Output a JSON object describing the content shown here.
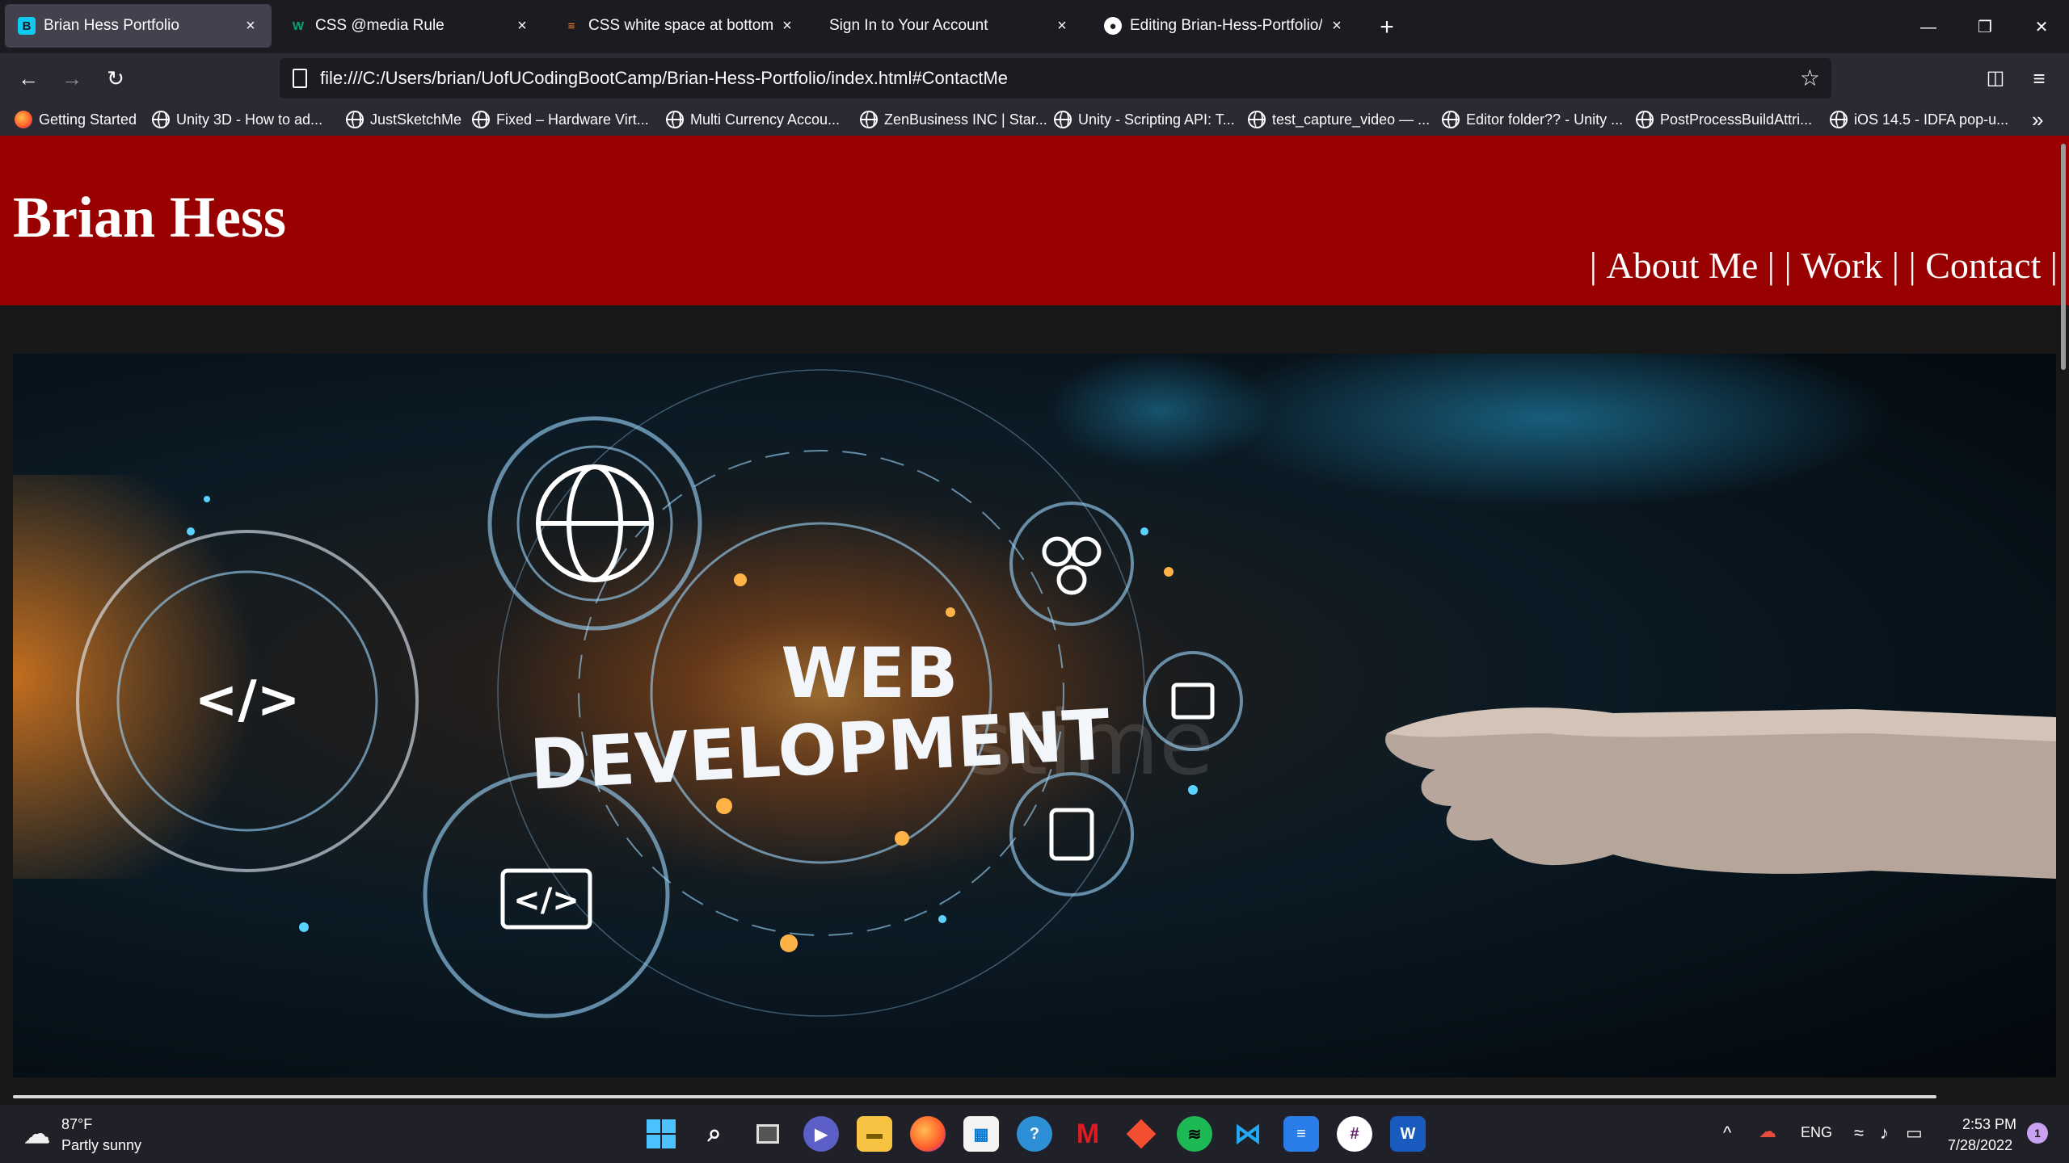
{
  "browser": {
    "tabs": [
      {
        "title": "Brian Hess Portfolio",
        "favicon": "bootstrap-icon",
        "favicon_color": "#0dcaf0",
        "active": true
      },
      {
        "title": "CSS @media Rule",
        "favicon": "w3schools-icon",
        "favicon_color": "#04aa6d",
        "active": false
      },
      {
        "title": "CSS white space at bottom of p",
        "favicon": "stackoverflow-icon",
        "favicon_color": "#f48024",
        "active": false
      },
      {
        "title": "Sign In to Your Account",
        "favicon": "",
        "favicon_color": "",
        "active": false
      },
      {
        "title": "Editing Brian-Hess-Portfolio/RE",
        "favicon": "github-icon",
        "favicon_color": "#ffffff",
        "active": false
      }
    ],
    "url": "file:///C:/Users/brian/UofUCodingBootCamp/Brian-Hess-Portfolio/index.html#ContactMe",
    "bookmarks": [
      {
        "label": "Getting Started",
        "icon": "firefox-icon"
      },
      {
        "label": "Unity 3D - How to ad...",
        "icon": "globe-icon"
      },
      {
        "label": "JustSketchMe",
        "icon": "globe-icon"
      },
      {
        "label": "Fixed – Hardware Virt...",
        "icon": "globe-icon"
      },
      {
        "label": "Multi Currency Accou...",
        "icon": "globe-icon"
      },
      {
        "label": "ZenBusiness INC | Star...",
        "icon": "globe-icon"
      },
      {
        "label": "Unity - Scripting API: T...",
        "icon": "globe-icon"
      },
      {
        "label": "test_capture_video — ...",
        "icon": "globe-icon"
      },
      {
        "label": "Editor folder?? - Unity ...",
        "icon": "globe-icon"
      },
      {
        "label": "PostProcessBuildAttri...",
        "icon": "globe-icon"
      },
      {
        "label": "iOS 14.5 - IDFA pop-u...",
        "icon": "globe-icon"
      }
    ]
  },
  "site": {
    "title": "Brian Hess",
    "nav": {
      "sep": "| ",
      "about": "About Me",
      "work": "Work",
      "contact": "Contact",
      "sep_mid": " | | ",
      "sep_end": " |"
    },
    "hero": {
      "line1": "WEB",
      "line2": "DEVELOPMENT",
      "watermark": "stime"
    },
    "colors": {
      "header": "#990000",
      "background": "#181818"
    }
  },
  "taskbar": {
    "weather": {
      "temp": "87°F",
      "condition": "Partly sunny"
    },
    "apps": [
      "windows-start-icon",
      "search-icon",
      "task-view-icon",
      "teams-chat-icon",
      "file-explorer-icon",
      "firefox-icon",
      "microsoft-store-icon",
      "help-icon",
      "mcafee-icon",
      "git-icon",
      "spotify-icon",
      "vscode-icon",
      "notepad-icon",
      "slack-icon",
      "word-icon"
    ],
    "language": "ENG",
    "time": "2:53 PM",
    "date": "7/28/2022",
    "notification_count": "1"
  }
}
